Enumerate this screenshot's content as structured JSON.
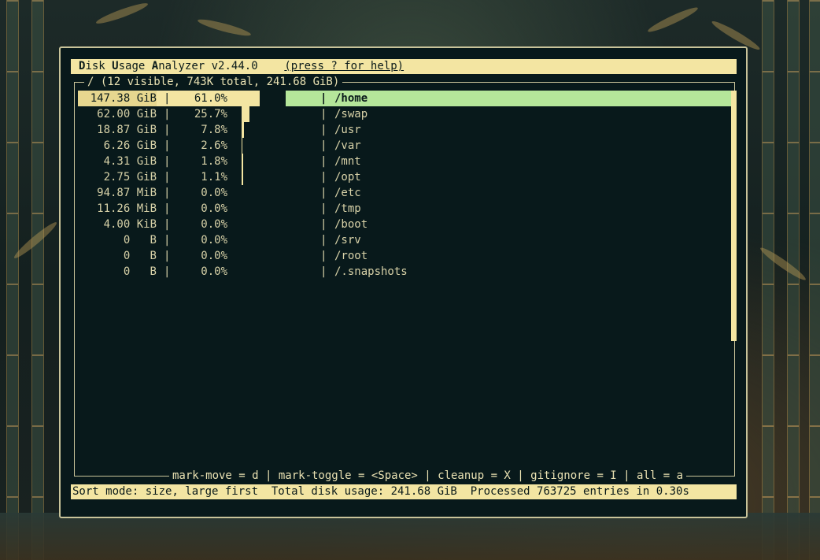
{
  "app": {
    "title_letters": [
      "D",
      "isk ",
      "U",
      "sage ",
      "A",
      "nalyzer v2.44.0"
    ],
    "help": "(press ? for help)"
  },
  "frame": {
    "title": "/ (12 visible, 743K total, 241.68 GiB)"
  },
  "rows": [
    {
      "size": "147.38 GiB",
      "pct": "61.0%",
      "name": "/home",
      "fraction": 0.61,
      "selected": true
    },
    {
      "size": "62.00 GiB",
      "pct": "25.7%",
      "name": "/swap",
      "fraction": 0.257
    },
    {
      "size": "18.87 GiB",
      "pct": "7.8%",
      "name": "/usr",
      "fraction": 0.078
    },
    {
      "size": "6.26 GiB",
      "pct": "2.6%",
      "name": "/var",
      "fraction": 0.026
    },
    {
      "size": "4.31 GiB",
      "pct": "1.8%",
      "name": "/mnt",
      "fraction": 0.018
    },
    {
      "size": "2.75 GiB",
      "pct": "1.1%",
      "name": "/opt",
      "fraction": 0.011
    },
    {
      "size": "94.87 MiB",
      "pct": "0.0%",
      "name": "/etc",
      "fraction": 0
    },
    {
      "size": "11.26 MiB",
      "pct": "0.0%",
      "name": "/tmp",
      "fraction": 0
    },
    {
      "size": "4.00 KiB",
      "pct": "0.0%",
      "name": "/boot",
      "fraction": 0
    },
    {
      "size": "0   B",
      "pct": "0.0%",
      "name": "/srv",
      "fraction": 0
    },
    {
      "size": "0   B",
      "pct": "0.0%",
      "name": "/root",
      "fraction": 0
    },
    {
      "size": "0   B",
      "pct": "0.0%",
      "name": "/.snapshots",
      "fraction": 0
    }
  ],
  "separator": "|",
  "keys": "mark-move = d | mark-toggle = <Space> | cleanup = X | gitignore = I | all = a",
  "status": "Sort mode: size, large first  Total disk usage: 241.68 GiB  Processed 763725 entries in 0.30s",
  "colors": {
    "accent": "#f3e5a2",
    "selected_name_bg": "#b5e69a",
    "terminal_bg": "#08191b"
  }
}
